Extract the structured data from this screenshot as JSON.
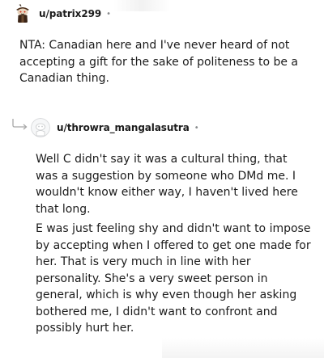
{
  "comments": [
    {
      "username": "u/patrix299",
      "separator": "•",
      "avatar": "snoo-avatar-icon",
      "paragraphs": [
        "NTA: Canadian here and I've never heard of not accepting a gift for the sake of politeness to be a Canadian thing."
      ]
    },
    {
      "username": "u/throwra_mangalasutra",
      "separator": "•",
      "avatar": "default-avatar-icon",
      "reply_icon": "reply-arrow-icon",
      "paragraphs": [
        "Well C didn't say it was a cultural thing, that was a suggestion by someone who DMd me. I wouldn't know either way, I haven't lived here that long.",
        "E was just feeling shy and didn't want to impose by accepting when I offered to get one made for her. That is very much in line with her personality. She's a very sweet person in general, which is why even though her asking bothered me, I didn't want to confront and possibly hurt her."
      ]
    }
  ],
  "colors": {
    "text": "#1c1c1c",
    "meta": "#878a8c",
    "reply_line": "#c8c8c8"
  }
}
